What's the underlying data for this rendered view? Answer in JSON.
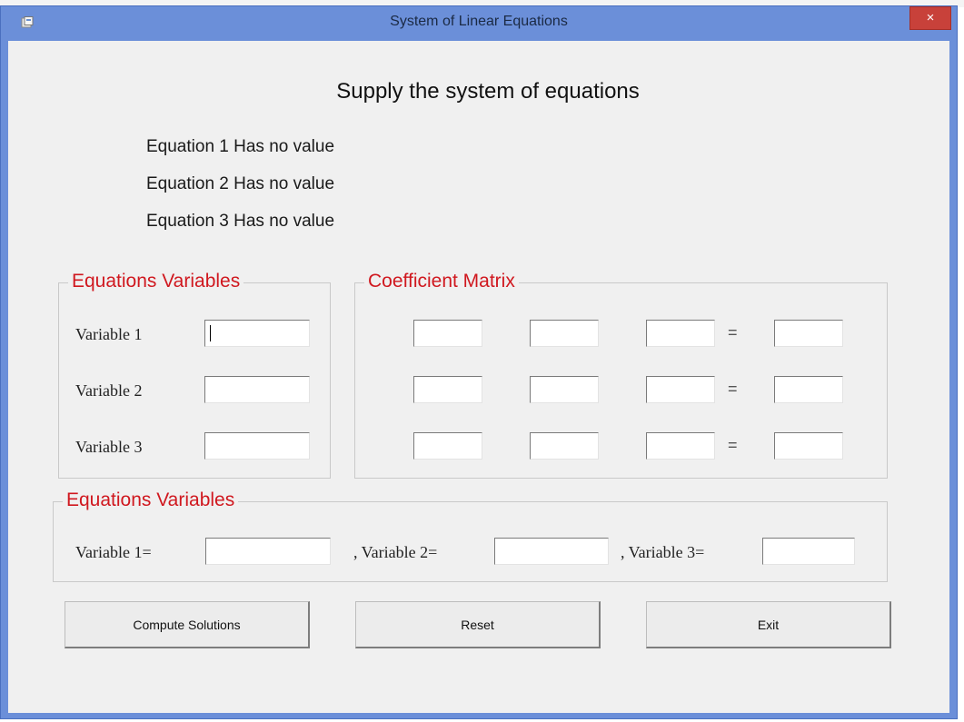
{
  "window": {
    "title": "System of Linear Equations",
    "close_glyph": "×",
    "app_icon": "app-icon"
  },
  "heading": "Supply the system of equations",
  "equation_status": [
    "Equation 1 Has no value",
    "Equation 2 Has no value",
    "Equation 3 Has no value"
  ],
  "variables_group": {
    "legend": "Equations Variables",
    "labels": [
      "Variable 1",
      "Variable 2",
      "Variable 3"
    ],
    "values": [
      "",
      "",
      ""
    ]
  },
  "coefficient_group": {
    "legend": "Coefficient Matrix",
    "equals_sign": "=",
    "rows": [
      [
        "",
        "",
        "",
        ""
      ],
      [
        "",
        "",
        "",
        ""
      ],
      [
        "",
        "",
        "",
        ""
      ]
    ]
  },
  "results_group": {
    "legend": "Equations Variables",
    "labels": [
      "Variable 1=",
      ", Variable 2=",
      ", Variable 3="
    ],
    "values": [
      "",
      "",
      ""
    ]
  },
  "buttons": {
    "compute": "Compute Solutions",
    "reset": "Reset",
    "exit": "Exit"
  },
  "colors": {
    "titlebar": "#6b8fd9",
    "legend": "#d0181f",
    "close": "#c8413a",
    "client": "#f0f0f0"
  }
}
